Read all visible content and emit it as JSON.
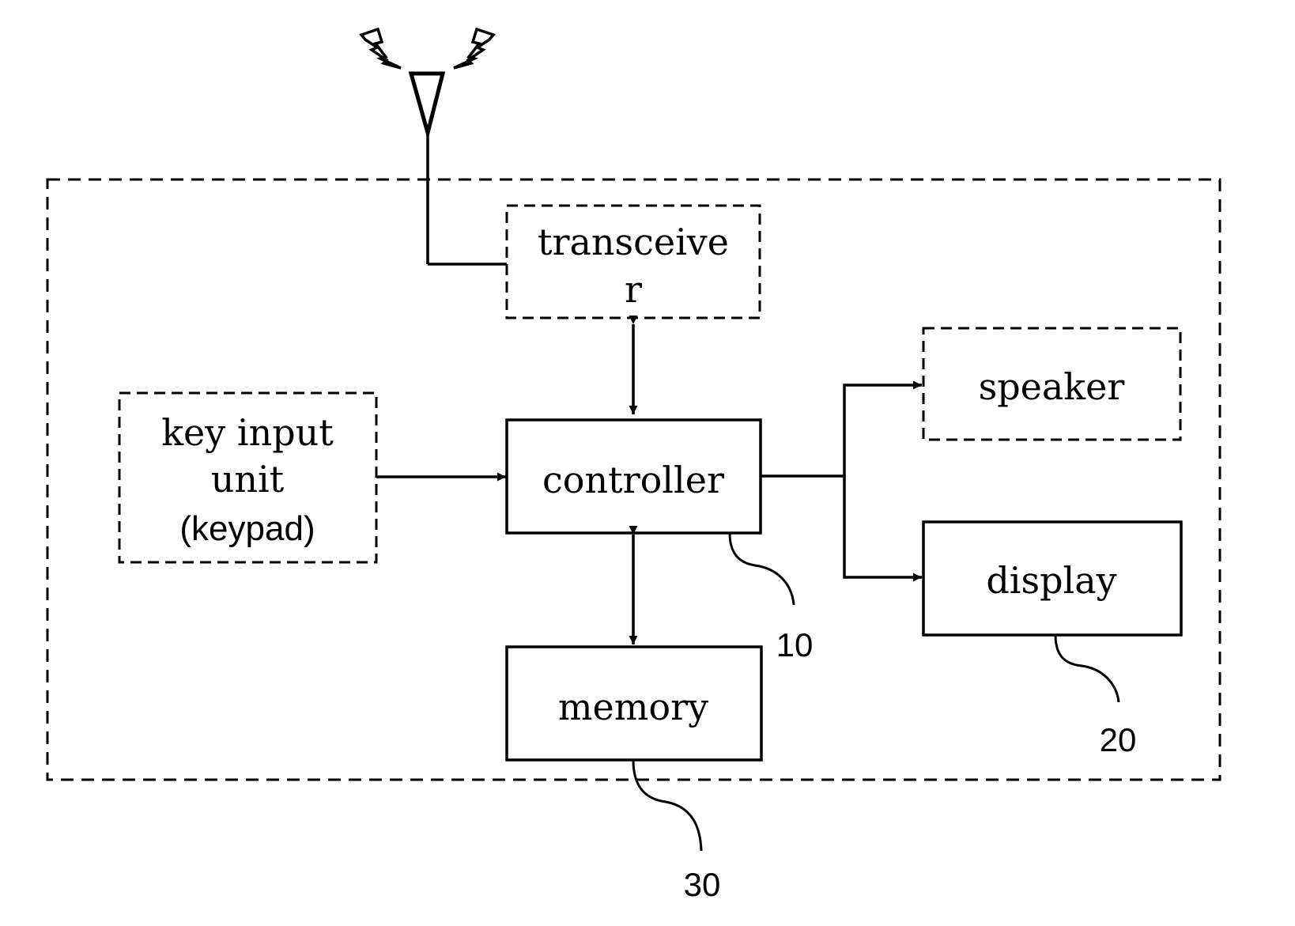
{
  "figure": {
    "description": "Block diagram of a mobile terminal",
    "colors": {
      "line": "#000000",
      "background": "#ffffff"
    }
  },
  "antenna": {
    "icon": "antenna-with-signal-icon"
  },
  "blocks": {
    "transceiver": {
      "line1": "transceive",
      "line2": "r",
      "style": "dashed"
    },
    "key_input": {
      "line1": "key input",
      "line2": "unit",
      "line3": "(keypad)",
      "style": "dashed"
    },
    "controller": {
      "label": "controller",
      "ref": "10",
      "style": "solid"
    },
    "speaker": {
      "label": "speaker",
      "style": "dashed"
    },
    "display": {
      "label": "display",
      "ref": "20",
      "style": "solid"
    },
    "memory": {
      "label": "memory",
      "ref": "30",
      "style": "solid"
    }
  },
  "connections": [
    {
      "from": "antenna",
      "to": "transceiver",
      "type": "line"
    },
    {
      "from": "transceiver",
      "to": "controller",
      "type": "bidirectional-arrow"
    },
    {
      "from": "key_input",
      "to": "controller",
      "type": "arrow"
    },
    {
      "from": "controller",
      "to": "speaker",
      "type": "arrow"
    },
    {
      "from": "controller",
      "to": "display",
      "type": "arrow"
    },
    {
      "from": "controller",
      "to": "memory",
      "type": "bidirectional-arrow"
    }
  ]
}
